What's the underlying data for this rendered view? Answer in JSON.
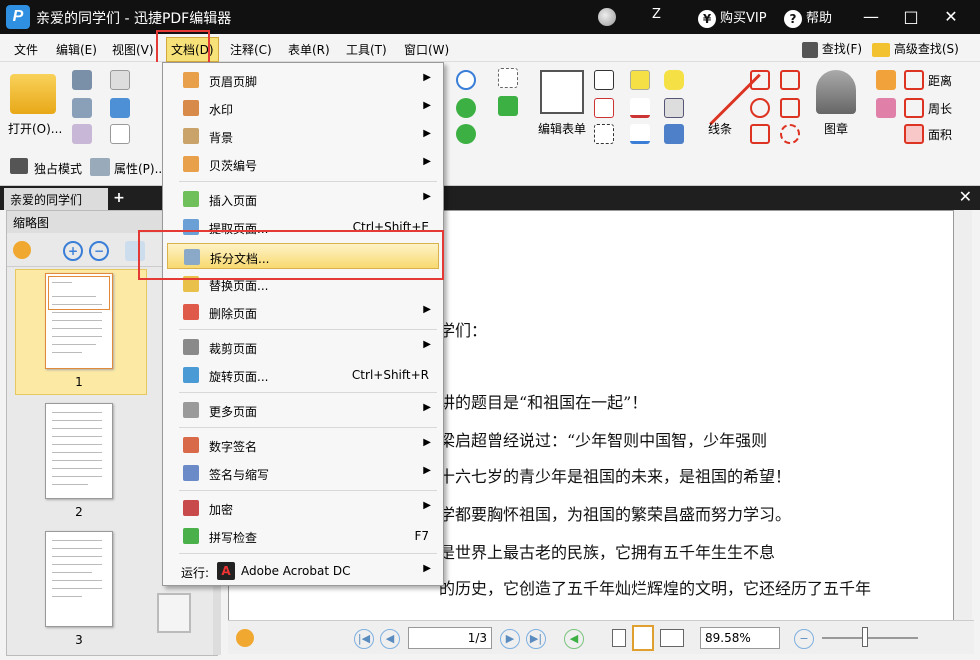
{
  "window": {
    "title": "亲爱的同学们 - 迅捷PDF编辑器",
    "user_initial": "Z",
    "buy_vip": "购买VIP",
    "help": "帮助",
    "minimize": "—",
    "maximize": "□",
    "close": "✕"
  },
  "menubar": {
    "items": [
      "文件",
      "编辑(E)",
      "视图(V)",
      "文档(D)",
      "注释(C)",
      "表单(R)",
      "工具(T)",
      "窗口(W)"
    ],
    "find": "查找(F)",
    "advanced_find": "高级查找(S)"
  },
  "toolbar": {
    "open": "打开(O)...",
    "exclusive_mode": "独占模式",
    "properties": "属性(P)...",
    "edit_form": "编辑表单",
    "lines": "线条",
    "stamp": "图章",
    "distance": "距离",
    "perimeter": "周长",
    "area": "面积"
  },
  "tabs": {
    "doc_tab": "亲爱的同学们",
    "add": "+",
    "close": "✕"
  },
  "thumbnails": {
    "title": "缩略图",
    "pages": [
      "1",
      "2",
      "3"
    ]
  },
  "dropdown": {
    "items": [
      {
        "label": "页眉页脚",
        "arrow": "▶"
      },
      {
        "label": "水印",
        "arrow": "▶"
      },
      {
        "label": "背景",
        "arrow": "▶"
      },
      {
        "label": "贝茨编号",
        "arrow": "▶"
      },
      {
        "label": "插入页面",
        "arrow": "▶"
      },
      {
        "label": "提取页面...",
        "shortcut": "Ctrl+Shift+E"
      },
      {
        "label": "拆分文档..."
      },
      {
        "label": "替换页面..."
      },
      {
        "label": "删除页面",
        "arrow": "▶"
      },
      {
        "label": "裁剪页面",
        "arrow": "▶"
      },
      {
        "label": "旋转页面...",
        "shortcut": "Ctrl+Shift+R"
      },
      {
        "label": "更多页面",
        "arrow": "▶"
      },
      {
        "label": "数字签名",
        "arrow": "▶"
      },
      {
        "label": "签名与缩写",
        "arrow": "▶"
      },
      {
        "label": "加密",
        "arrow": "▶"
      },
      {
        "label": "拼写检查",
        "shortcut": "F7"
      }
    ],
    "run_label": "运行:",
    "run_app": "Adobe Acrobat DC",
    "run_arrow": "▶"
  },
  "document": {
    "lines": [
      "学们：",
      "讲的题目是“和祖国在一起”！",
      "梁启超曾经说过：“少年智则中国智，少年强则",
      "十六七岁的青少年是祖国的未来，是祖国的希望！",
      "学都要胸怀祖国，为祖国的繁荣昌盛而努力学习。",
      "是世界上最古老的民族，它拥有五千年生生不息",
      "的历史，它创造了五千年灿烂辉煌的文明，它还经历了五千年"
    ]
  },
  "status": {
    "page_value": "1/3",
    "zoom": "89.58%"
  },
  "colors": {
    "highlight_red": "#e53935",
    "menu_active": "#f7e27a",
    "selected_thumb": "#fbe9a4"
  }
}
